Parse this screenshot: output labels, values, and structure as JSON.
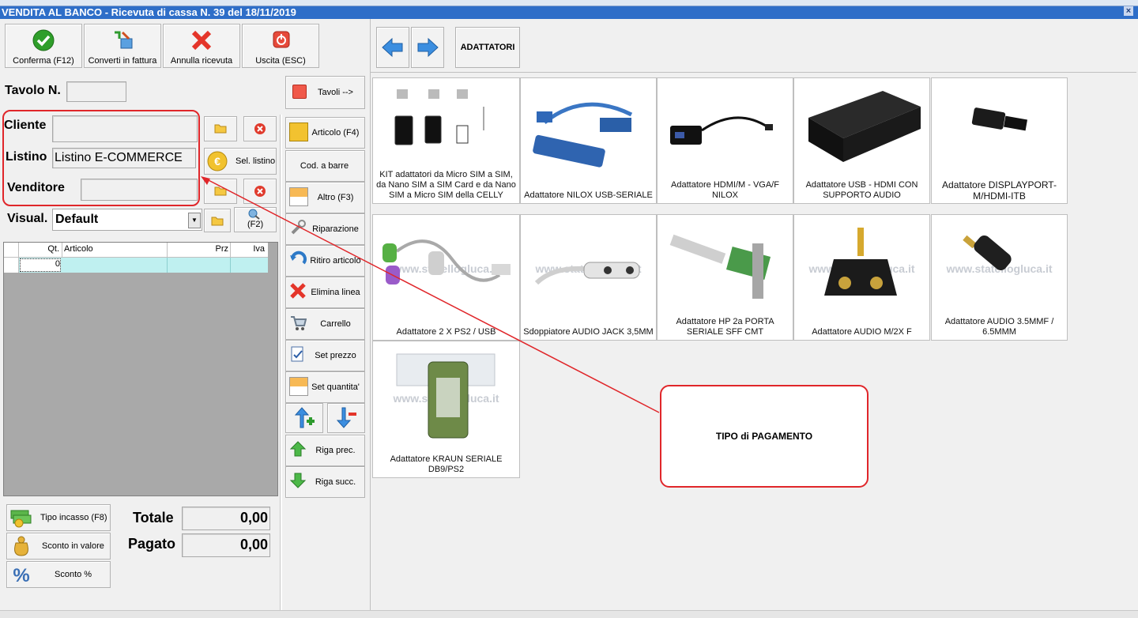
{
  "window": {
    "title": "VENDITA AL BANCO - Ricevuta di cassa N. 39 del 18/11/2019",
    "close_glyph": "×"
  },
  "toolbar": {
    "confirm_label": "Conferma (F12)",
    "convert_label": "Converti in fattura",
    "cancel_label": "Annulla ricevuta",
    "exit_label": "Uscita (ESC)"
  },
  "form": {
    "table_label": "Tavolo N.",
    "table_value": "",
    "tables_button": "Tavoli -->",
    "client_label": "Cliente",
    "client_value": "",
    "pricelist_label": "Listino",
    "pricelist_value": "Listino E-COMMERCE",
    "select_pricelist_label": "Sel. listino",
    "seller_label": "Venditore",
    "seller_value": "",
    "view_label": "Visual.",
    "view_value": "Default",
    "f2_label": "(F2)"
  },
  "grid": {
    "columns": [
      "Qt.",
      "Articolo",
      "Prz",
      "Iva"
    ],
    "rows": [
      {
        "qt": "0",
        "articolo": "",
        "prz": "",
        "iva": ""
      }
    ]
  },
  "side_buttons": {
    "articolo": "Articolo (F4)",
    "barcode": "Cod. a barre",
    "altro": "Altro (F3)",
    "riparazione": "Riparazione",
    "ritiro": "Ritiro articolo",
    "elimina": "Elimina linea",
    "carrello": "Carrello",
    "set_prezzo": "Set prezzo",
    "set_quantita": "Set quantita'",
    "riga_prec": "Riga prec.",
    "riga_succ": "Riga succ."
  },
  "bottom": {
    "payment_type": "Tipo incasso (F8)",
    "discount_value": "Sconto in valore",
    "discount_pct": "Sconto %",
    "total_label": "Totale",
    "total_value": "0,00",
    "paid_label": "Pagato",
    "paid_value": "0,00"
  },
  "catalog": {
    "category": "ADATTATORI",
    "watermark": "www.statellogluca.it",
    "products": [
      {
        "name": "KIT adattatori da Micro SIM a SIM, da Nano SIM a SIM Card e da Nano SIM a Micro SIM della CELLY"
      },
      {
        "name": "Adattatore NILOX USB-SERIALE"
      },
      {
        "name": "Adattatore  HDMI/M - VGA/F NILOX"
      },
      {
        "name": "Adattatore USB - HDMI CON SUPPORTO AUDIO"
      },
      {
        "name": "Adattatore DISPLAYPORT-M/HDMI-ITB"
      },
      {
        "name": "Adattatore 2 X PS2 / USB"
      },
      {
        "name": "Sdoppiatore AUDIO JACK 3,5MM"
      },
      {
        "name": "Adattatore HP 2a PORTA SERIALE SFF CMT"
      },
      {
        "name": "Adattatore AUDIO M/2X F"
      },
      {
        "name": "Adattatore AUDIO 3.5MMF / 6.5MMM"
      },
      {
        "name": "Adattatore KRAUN SERIALE DB9/PS2"
      }
    ]
  },
  "annotation": {
    "callout_text": "TIPO di PAGAMENTO",
    "color": "#e0262a"
  }
}
